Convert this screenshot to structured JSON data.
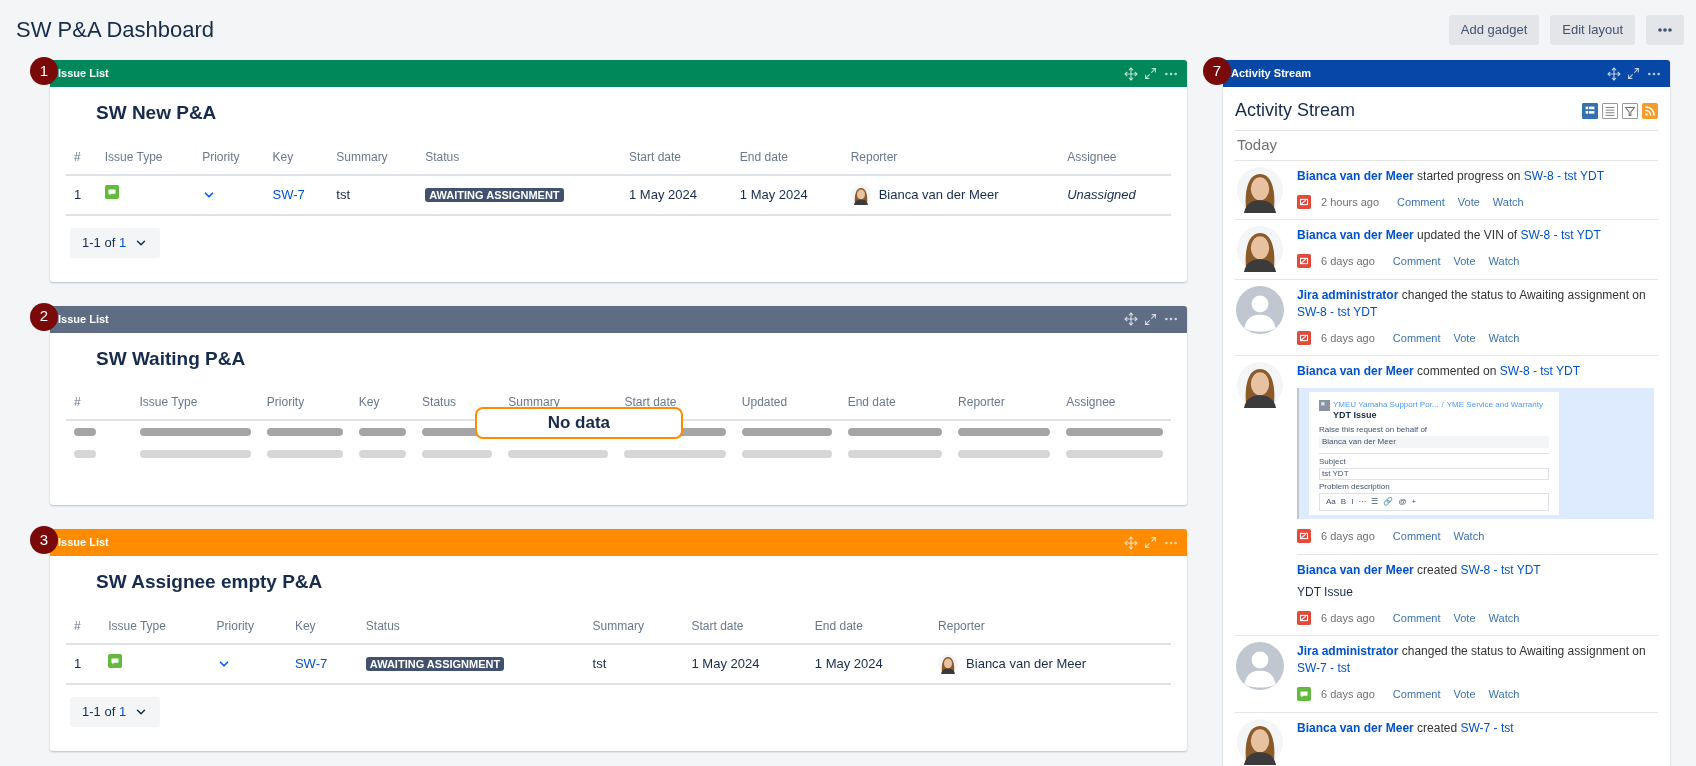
{
  "title": "SW P&A Dashboard",
  "header_buttons": [
    "Add gadget",
    "Edit layout"
  ],
  "gadgets": [
    {
      "number": "1",
      "title": "Issue List",
      "color": "#00875a",
      "filter_title": "SW New P&A",
      "kind": "table",
      "columns": [
        "#",
        "Issue Type",
        "Priority",
        "Key",
        "Summary",
        "Status",
        "Start date",
        "End date",
        "Reporter",
        "Assignee"
      ],
      "rows": [
        [
          {
            "kind": "number",
            "text": "1"
          },
          {
            "kind": "issue_type"
          },
          {
            "kind": "priority"
          },
          {
            "kind": "key",
            "text": "SW-7"
          },
          {
            "kind": "text",
            "text": "tst"
          },
          {
            "kind": "status",
            "text": "AWAITING ASSIGNMENT"
          },
          {
            "kind": "text",
            "text": "1 May 2024"
          },
          {
            "kind": "text",
            "text": "1 May 2024"
          },
          {
            "kind": "user",
            "text": "Bianca van der Meer"
          },
          {
            "kind": "unassigned",
            "text": "Unassigned"
          }
        ]
      ],
      "pagination": {
        "label": "1-1 of",
        "total": "1"
      }
    },
    {
      "number": "2",
      "title": "Issue List",
      "color": "#5e6c84",
      "filter_title": "SW Waiting P&A",
      "kind": "empty",
      "columns": [
        "#",
        "Issue Type",
        "Priority",
        "Key",
        "Status",
        "Summary",
        "Start date",
        "Updated",
        "End date",
        "Reporter",
        "Assignee"
      ],
      "message": "No data"
    },
    {
      "number": "3",
      "title": "Issue List",
      "color": "#ff8b00",
      "filter_title": "SW Assignee empty P&A",
      "kind": "table",
      "columns": [
        "#",
        "Issue Type",
        "Priority",
        "Key",
        "Status",
        "Summary",
        "Start date",
        "End date",
        "Reporter"
      ],
      "rows": [
        [
          {
            "kind": "number",
            "text": "1"
          },
          {
            "kind": "issue_type"
          },
          {
            "kind": "priority"
          },
          {
            "kind": "key",
            "text": "SW-7"
          },
          {
            "kind": "status",
            "text": "AWAITING ASSIGNMENT"
          },
          {
            "kind": "text",
            "text": "tst"
          },
          {
            "kind": "text",
            "text": "1 May 2024"
          },
          {
            "kind": "text",
            "text": "1 May 2024"
          },
          {
            "kind": "user",
            "text": "Bianca van der Meer"
          }
        ]
      ],
      "pagination": {
        "label": "1-1 of",
        "total": "1"
      }
    }
  ],
  "activity": {
    "number": "7",
    "title": "Activity Stream",
    "heading": "Activity Stream",
    "views": [
      {
        "kind": "full",
        "selected": true
      },
      {
        "kind": "list",
        "selected": false
      },
      {
        "kind": "filter",
        "selected": false
      }
    ],
    "day": "Today",
    "items": [
      {
        "avatar": {
          "kind": "person"
        },
        "actor": "Bianca van der Meer",
        "action": "started progress on",
        "target": "SW-8 - tst YDT",
        "type_icon": {
          "kind": "change"
        },
        "time": "2 hours ago",
        "actions": [
          "Comment",
          "Vote",
          "Watch"
        ]
      },
      {
        "avatar": {
          "kind": "person"
        },
        "actor": "Bianca van der Meer",
        "action": "updated the VIN of",
        "target": "SW-8 - tst YDT",
        "type_icon": {
          "kind": "change"
        },
        "time": "6 days ago",
        "actions": [
          "Comment",
          "Vote",
          "Watch"
        ]
      },
      {
        "avatar": {
          "kind": "generic"
        },
        "actor": "Jira administrator",
        "action": "changed the status to Awaiting assignment on",
        "target": "SW-8 - tst YDT",
        "type_icon": {
          "kind": "change"
        },
        "time": "6 days ago",
        "actions": [
          "Comment",
          "Vote",
          "Watch"
        ]
      },
      {
        "avatar": {
          "kind": "person"
        },
        "actor": "Bianca van der Meer",
        "action": "commented on",
        "target": "SW-8 - tst YDT",
        "attachment": {
          "breadcrumb": [
            "YMEU Yamaha Support Por...",
            "/",
            "YME Service and Warranty"
          ],
          "page_title": "YDT Issue",
          "fields": [
            {
              "label": "Raise this request on behalf of",
              "value": "Bianca van der Meer",
              "kind": "select"
            },
            {
              "label": "Subject",
              "value": "tst YDT",
              "kind": "input"
            },
            {
              "label": "Problem description",
              "kind": "editor",
              "toolbar": [
                "Aa",
                "B",
                "I",
                "···",
                "☰",
                "🔗",
                "@",
                "+"
              ]
            }
          ]
        },
        "type_icon": {
          "kind": "change"
        },
        "time": "6 days ago",
        "actions": [
          "Comment",
          "Watch"
        ]
      },
      {
        "actor": "Bianca van der Meer",
        "action": "created",
        "target": "SW-8 - tst YDT",
        "description": "YDT Issue",
        "type_icon": {
          "kind": "change"
        },
        "time": "6 days ago",
        "actions": [
          "Comment",
          "Vote",
          "Watch"
        ]
      },
      {
        "avatar": {
          "kind": "generic"
        },
        "actor": "Jira administrator",
        "action": "changed the status to Awaiting assignment on",
        "target": "SW-7 - tst",
        "type_icon": {
          "kind": "comment"
        },
        "time": "6 days ago",
        "actions": [
          "Comment",
          "Vote",
          "Watch"
        ]
      },
      {
        "avatar": {
          "kind": "person"
        },
        "actor": "Bianca van der Meer",
        "action": "created",
        "target": "SW-7 - tst"
      }
    ]
  }
}
